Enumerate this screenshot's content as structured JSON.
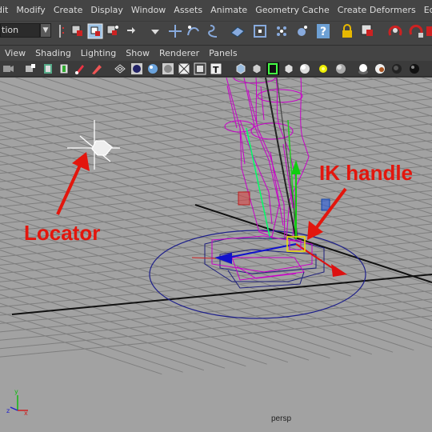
{
  "menubar": {
    "items": [
      "dit",
      "Modify",
      "Create",
      "Display",
      "Window",
      "Assets",
      "Animate",
      "Geometry Cache",
      "Create Deformers",
      "Edit"
    ]
  },
  "statusline": {
    "mode_value": "tion",
    "icons": [
      "select-by-hierarchy-icon",
      "select-by-object-icon",
      "select-by-component-icon",
      "snap-to-grid-icon",
      "snap-to-curve-icon",
      "snap-to-point-icon",
      "snap-to-plane-icon",
      "make-live-icon",
      "render-icon",
      "ipr-render-icon",
      "help-icon",
      "lock-icon",
      "selection-mask-icon",
      "magnet-icon",
      "history-icon"
    ]
  },
  "panel_menu": {
    "items": [
      "View",
      "Shading",
      "Lighting",
      "Show",
      "Renderer",
      "Panels"
    ]
  },
  "viewport": {
    "camera_label": "persp",
    "annotations": {
      "locator": "Locator",
      "ik_handle": "IK handle"
    },
    "annotation_color": "#e3160d"
  },
  "colors": {
    "wireframe_selected": "#c800c8",
    "grid_major": "#111111",
    "viewport_bg": "#a2a2a2"
  }
}
